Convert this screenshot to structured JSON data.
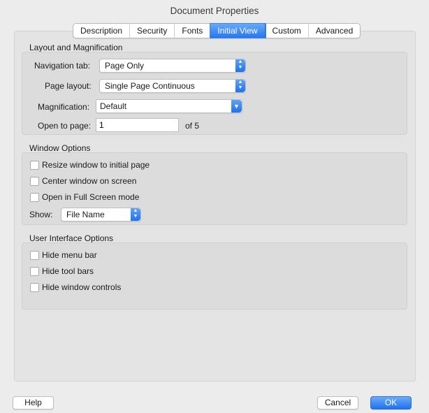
{
  "window": {
    "title": "Document Properties"
  },
  "tabs": [
    "Description",
    "Security",
    "Fonts",
    "Initial View",
    "Custom",
    "Advanced"
  ],
  "active_tab": "Initial View",
  "layout": {
    "title": "Layout and Magnification",
    "nav_tab_label": "Navigation tab:",
    "nav_tab_value": "Page Only",
    "page_layout_label": "Page layout:",
    "page_layout_value": "Single Page Continuous",
    "magnification_label": "Magnification:",
    "magnification_value": "Default",
    "open_to_page_label": "Open to page:",
    "open_to_page_value": "1",
    "of_pages": "of 5"
  },
  "window_options": {
    "title": "Window Options",
    "resize": "Resize window to initial page",
    "center": "Center window on screen",
    "fullscreen": "Open in Full Screen mode",
    "show_label": "Show:",
    "show_value": "File Name"
  },
  "ui_options": {
    "title": "User Interface Options",
    "hide_menu_bar": "Hide menu bar",
    "hide_tool_bars": "Hide tool bars",
    "hide_window_controls": "Hide window controls"
  },
  "buttons": {
    "help": "Help",
    "cancel": "Cancel",
    "ok": "OK"
  },
  "colors": {
    "accent": "#2477f0",
    "background": "#ececec",
    "group": "#dcdcdc"
  }
}
